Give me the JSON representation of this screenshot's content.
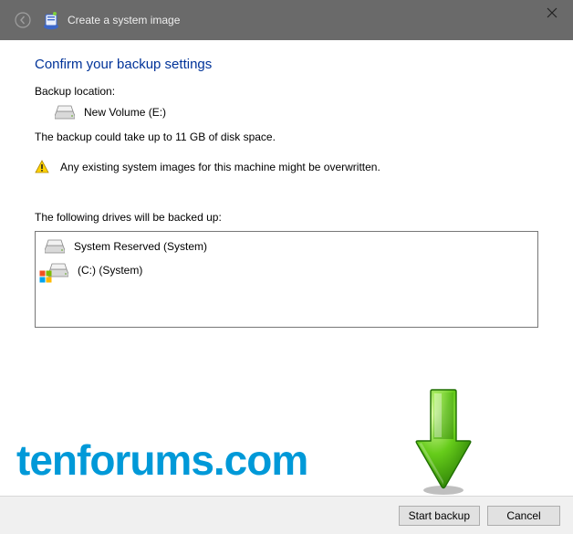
{
  "titlebar": {
    "title": "Create a system image"
  },
  "main": {
    "heading": "Confirm your backup settings",
    "backup_location_label": "Backup location:",
    "backup_location_value": "New Volume (E:)",
    "size_note": "The backup could take up to 11 GB of disk space.",
    "warning_text": "Any existing system images for this machine might be overwritten.",
    "drives_label": "The following drives will be backed up:",
    "drives": [
      {
        "name": "System Reserved (System)"
      },
      {
        "name": "(C:) (System)"
      }
    ]
  },
  "buttons": {
    "start": "Start backup",
    "cancel": "Cancel"
  },
  "watermark": "tenforums.com"
}
